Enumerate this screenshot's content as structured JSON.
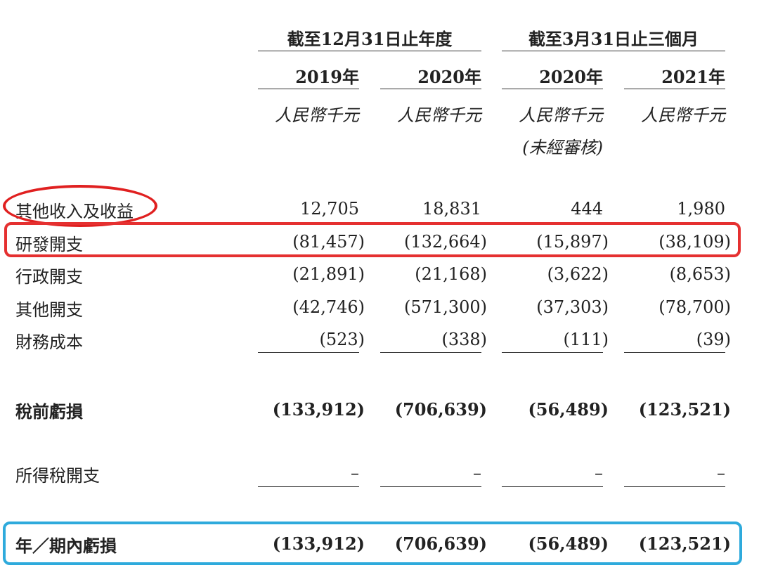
{
  "header": {
    "period_annual": "截至12月31日止年度",
    "period_quarter": "截至3月31日止三個月",
    "years": [
      "2019年",
      "2020年",
      "2020年",
      "2021年"
    ],
    "unit": "人民幣千元",
    "unaudited": "(未經審核)"
  },
  "rows": [
    {
      "label": "其他收入及收益",
      "values": [
        "12,705",
        "18,831",
        "444",
        "1,980"
      ]
    },
    {
      "label": "研發開支",
      "values": [
        "(81,457)",
        "(132,664)",
        "(15,897)",
        "(38,109)"
      ]
    },
    {
      "label": "行政開支",
      "values": [
        "(21,891)",
        "(21,168)",
        "(3,622)",
        "(8,653)"
      ]
    },
    {
      "label": "其他開支",
      "values": [
        "(42,746)",
        "(571,300)",
        "(37,303)",
        "(78,700)"
      ]
    },
    {
      "label": "財務成本",
      "values": [
        "(523)",
        "(338)",
        "(111)",
        "(39)"
      ]
    },
    {
      "label": "稅前虧損",
      "values": [
        "(133,912)",
        "(706,639)",
        "(56,489)",
        "(123,521)"
      ]
    },
    {
      "label": "所得稅開支",
      "values": [
        "–",
        "–",
        "–",
        "–"
      ]
    },
    {
      "label": "年／期內虧損",
      "values": [
        "(133,912)",
        "(706,639)",
        "(56,489)",
        "(123,521)"
      ]
    }
  ],
  "highlight_colors": {
    "ellipse": "#e02020",
    "red_box": "#e53030",
    "blue_box": "#2eaadc"
  }
}
